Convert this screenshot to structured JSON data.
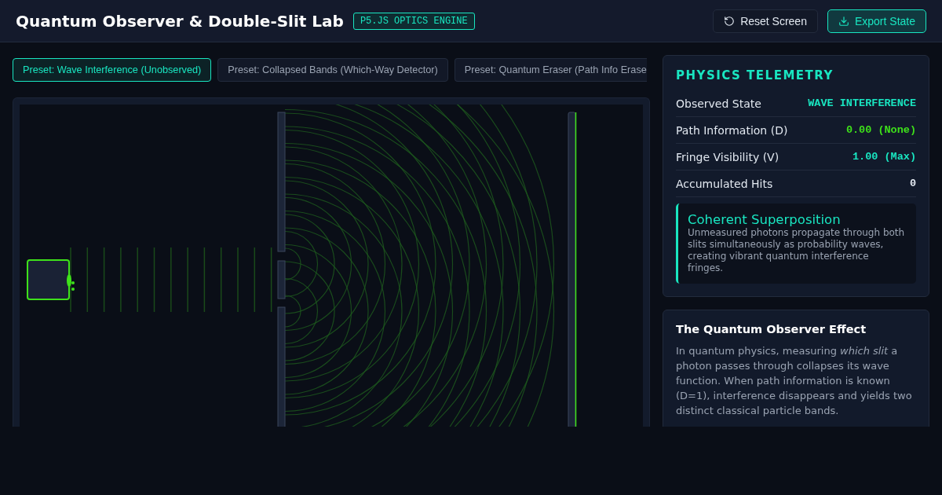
{
  "header": {
    "title": "Quantum Observer & Double-Slit Lab",
    "badge": "P5.JS OPTICS ENGINE",
    "buttons": [
      {
        "kind": "reset",
        "label": "Reset Screen"
      },
      {
        "kind": "export",
        "label": "Export State"
      }
    ]
  },
  "presets": [
    {
      "label": "Preset: Wave Interference (Unobserved)",
      "selected": true
    },
    {
      "label": "Preset: Collapsed Bands (Which-Way Detector)",
      "selected": false
    },
    {
      "label": "Preset: Quantum Eraser (Path Info Erase",
      "selected": false
    }
  ],
  "telemetry": {
    "title": "PHYSICS TELEMETRY",
    "rows": [
      {
        "label": "Observed State",
        "value": "WAVE INTERFERENCE",
        "color": "#19e6c1"
      },
      {
        "label": "Path Information (D)",
        "value": "0.00 (None)",
        "color": "#3ee11a"
      },
      {
        "label": "Fringe Visibility (V)",
        "value": "1.00 (Max)",
        "color": "#19e6c1"
      },
      {
        "label": "Accumulated Hits",
        "value": "0",
        "color": "#e2e8f0"
      }
    ],
    "callout": {
      "title": "Coherent Superposition",
      "text": "Unmeasured photons propagate through both slits simultaneously as probability waves, creating vibrant quantum interference fringes."
    }
  },
  "info": {
    "title": "The Quantum Observer Effect",
    "text": "In quantum physics, measuring *which slit* a photon passes through collapses its wave function. When path information is known (D=1), interference disappears and yields two distinct classical particle bands."
  }
}
